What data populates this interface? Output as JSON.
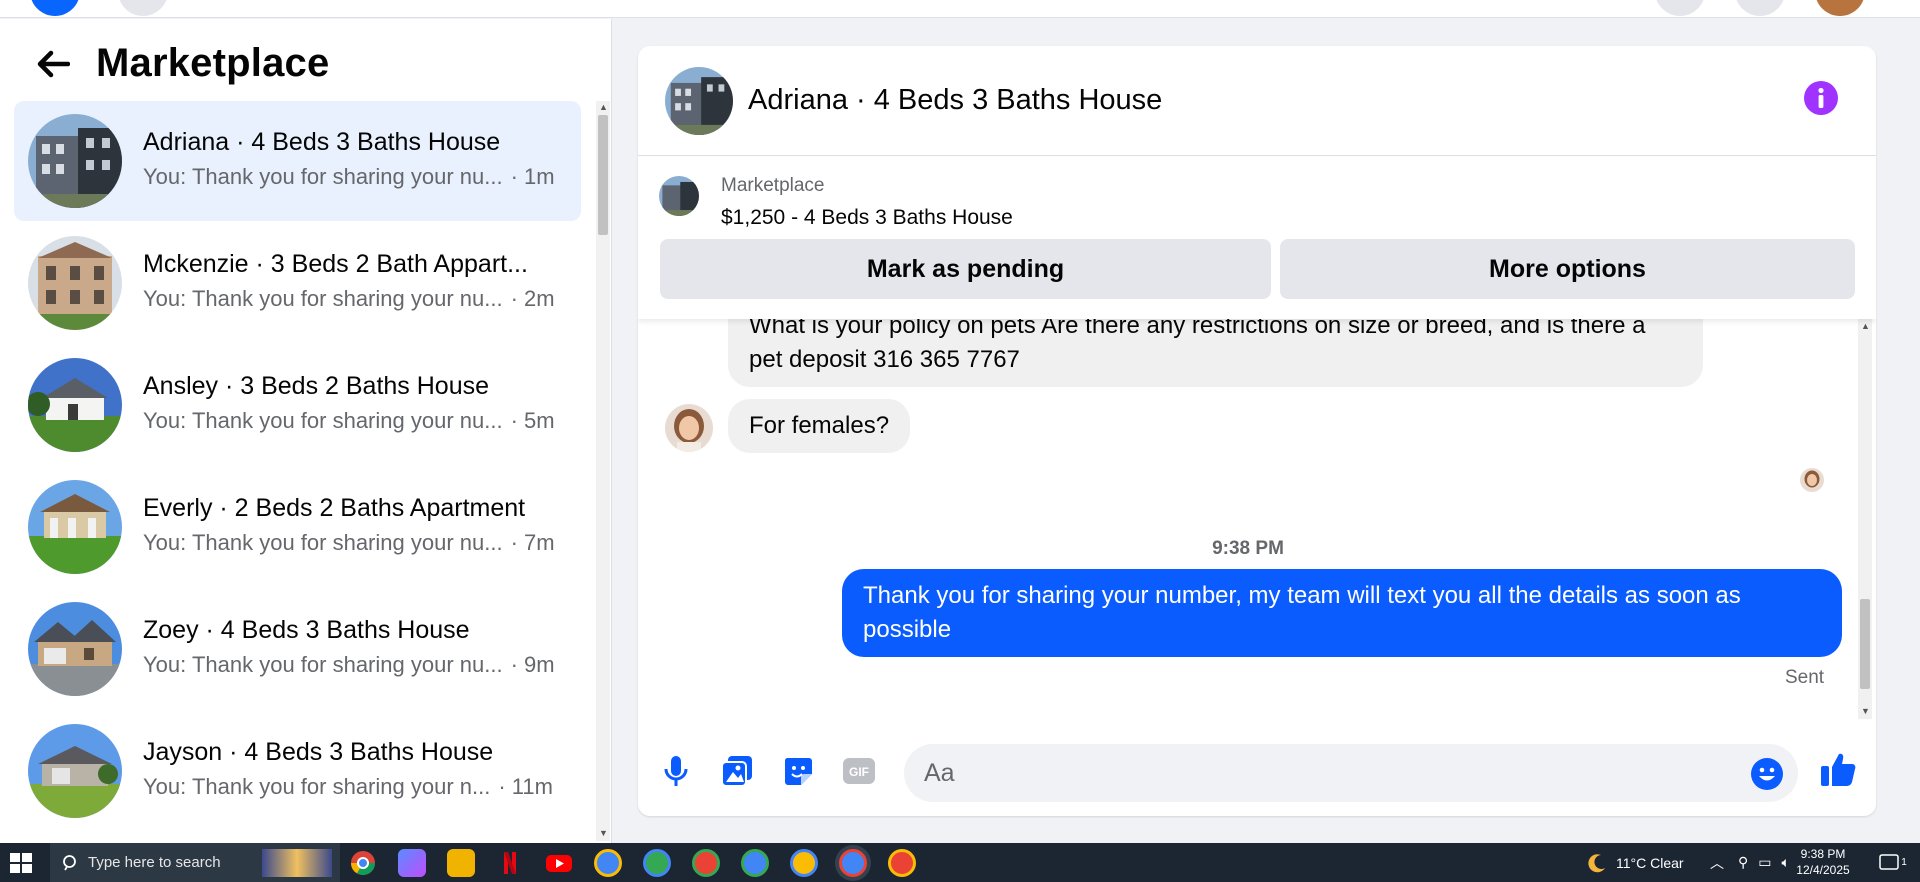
{
  "colors": {
    "accent": "#0a5cff",
    "active_row": "#e8f1fd",
    "info_purple": "#a033ff",
    "bubble_in": "#f0f0f0",
    "taskbar": "#1c2633"
  },
  "sidebar": {
    "title": "Marketplace",
    "back_icon": "arrow-left-icon",
    "conversations": [
      {
        "title": "Adriana · 4 Beds 3 Baths House",
        "snippet": "You: Thank you for sharing your nu...",
        "time": "· 1m",
        "active": true
      },
      {
        "title": "Mckenzie · 3 Beds 2 Bath Appart...",
        "snippet": "You: Thank you for sharing your nu...",
        "time": "· 2m",
        "active": false
      },
      {
        "title": "Ansley · 3 Beds 2 Baths House",
        "snippet": "You: Thank you for sharing your nu...",
        "time": "· 5m",
        "active": false
      },
      {
        "title": "Everly · 2 Beds 2 Baths Apartment",
        "snippet": "You: Thank you for sharing your nu...",
        "time": "· 7m",
        "active": false
      },
      {
        "title": "Zoey · 4 Beds 3 Baths House",
        "snippet": "You: Thank you for sharing your nu...",
        "time": "· 9m",
        "active": false
      },
      {
        "title": "Jayson · 4 Beds 3 Baths House",
        "snippet": "You: Thank you for sharing your n...",
        "time": "· 11m",
        "active": false
      }
    ]
  },
  "chat": {
    "title": "Adriana · 4 Beds 3 Baths House",
    "info_icon": "info-icon",
    "listing": {
      "label": "Marketplace",
      "price_title": "$1,250 - 4 Beds 3 Baths House",
      "pending_button": "Mark as pending",
      "options_button": "More options"
    },
    "messages": {
      "incoming_1": "What is your policy on pets Are there any restrictions on size or breed, and is there a pet deposit  316 365 7767",
      "incoming_2": "For females?",
      "timestamp": "9:38 PM",
      "outgoing_1": "Thank you for  sharing your number, my team will text you all the details as soon as possible",
      "status": "Sent"
    },
    "composer": {
      "placeholder": "Aa",
      "icons": [
        "microphone-icon",
        "photo-icon",
        "sticker-icon",
        "gif-icon",
        "emoji-icon",
        "thumbs-up-icon"
      ]
    }
  },
  "taskbar": {
    "search_placeholder": "Type here to search",
    "weather": "11°C  Clear",
    "time": "9:38 PM",
    "date": "12/4/2025",
    "notification_count": "1"
  }
}
